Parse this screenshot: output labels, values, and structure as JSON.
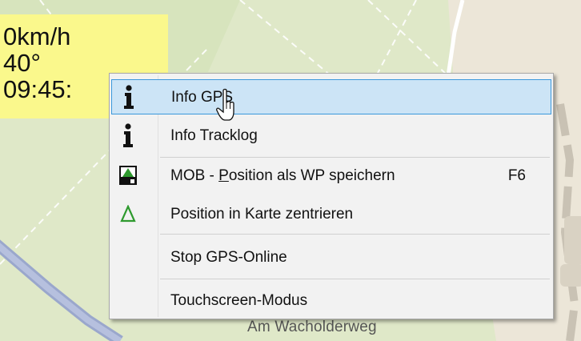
{
  "map": {
    "street_label": "Am Wacholderweg"
  },
  "gps": {
    "speed": "0km/h",
    "heading": "40°",
    "time": "09:45:"
  },
  "menu": {
    "items": [
      {
        "label": "Info GPS",
        "icon": "info-icon",
        "highlighted": true
      },
      {
        "label": "Info Tracklog",
        "icon": "info-icon"
      },
      {
        "label_pre": "MOB - ",
        "label_mnemonic": "P",
        "label_post": "osition als WP speichern",
        "shortcut": "F6",
        "icon": "mob-flag-icon"
      },
      {
        "label": "Position in Karte zentrieren",
        "icon": "triangle-icon"
      },
      {
        "label": "Stop GPS-Online"
      },
      {
        "label": "Touchscreen-Modus"
      }
    ]
  },
  "colors": {
    "gps_panel": "#faf88c",
    "menu_highlight": "#cce4f6",
    "menu_highlight_border": "#3b98dc",
    "triangle_green": "#2e9a2e"
  }
}
